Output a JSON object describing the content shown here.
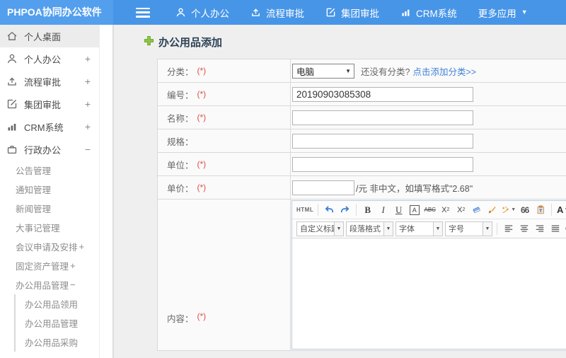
{
  "header": {
    "logo": "PHPOA协同办公软件",
    "nav": [
      {
        "label": "个人办公",
        "icon": "user-icon"
      },
      {
        "label": "流程审批",
        "icon": "process-upload-icon"
      },
      {
        "label": "集团审批",
        "icon": "edit-square-icon"
      },
      {
        "label": "CRM系统",
        "icon": "bar-chart-icon"
      },
      {
        "label": "更多应用",
        "icon": "caret-down-icon"
      }
    ]
  },
  "sidebar": {
    "items": [
      {
        "label": "个人桌面",
        "icon": "home-icon",
        "expand": ""
      },
      {
        "label": "个人办公",
        "icon": "user-icon",
        "expand": "+"
      },
      {
        "label": "流程审批",
        "icon": "process-upload-icon",
        "expand": "+"
      },
      {
        "label": "集团审批",
        "icon": "edit-square-icon",
        "expand": "+"
      },
      {
        "label": "CRM系统",
        "icon": "bar-chart-icon",
        "expand": "+"
      },
      {
        "label": "行政办公",
        "icon": "briefcase-icon",
        "expand": "−"
      }
    ],
    "subitems": [
      {
        "label": "公告管理",
        "expand": ""
      },
      {
        "label": "通知管理",
        "expand": ""
      },
      {
        "label": "新闻管理",
        "expand": ""
      },
      {
        "label": "大事记管理",
        "expand": ""
      },
      {
        "label": "会议申请及安排",
        "expand": "+"
      },
      {
        "label": "固定资产管理",
        "expand": " +"
      },
      {
        "label": "办公用品管理",
        "expand": " −"
      }
    ],
    "subsubitems": [
      {
        "label": "办公用品领用"
      },
      {
        "label": "办公用品管理"
      },
      {
        "label": "办公用品采购"
      }
    ]
  },
  "main": {
    "title": "办公用品添加",
    "form": {
      "category": {
        "label": "分类：",
        "required": "(*)",
        "selected": "电脑",
        "hint": "还没有分类?",
        "link": "点击添加分类>>"
      },
      "code": {
        "label": "编号：",
        "required": "(*)",
        "value": "20190903085308"
      },
      "name": {
        "label": "名称：",
        "required": "(*)",
        "value": ""
      },
      "spec": {
        "label": "规格：",
        "required": "",
        "value": ""
      },
      "unit": {
        "label": "单位：",
        "required": "(*)",
        "value": ""
      },
      "price": {
        "label": "单价：",
        "required": "(*)",
        "value": "",
        "suffix": "/元 非中文，如填写格式\"2.68\""
      },
      "content": {
        "label": "内容：",
        "required": "(*)"
      }
    }
  },
  "editor": {
    "buttons": {
      "source": "HTML",
      "bold": "B",
      "italic": "I",
      "underline": "U",
      "boxed_a": "A",
      "strike": "ABC",
      "sup_base": "X",
      "sup_exp": "2",
      "sub_base": "X",
      "sub_exp": "2",
      "quote": "66",
      "font_color": "A",
      "highlight": "ab"
    },
    "dropdowns": [
      "自定义标题",
      "段落格式",
      "字体",
      "字号"
    ]
  },
  "colors": {
    "header_blue": "#4795e7",
    "logo_blue": "#539fed",
    "link_blue": "#4183d7",
    "required_red": "#e24d44",
    "add_green": "#8dc63f"
  }
}
